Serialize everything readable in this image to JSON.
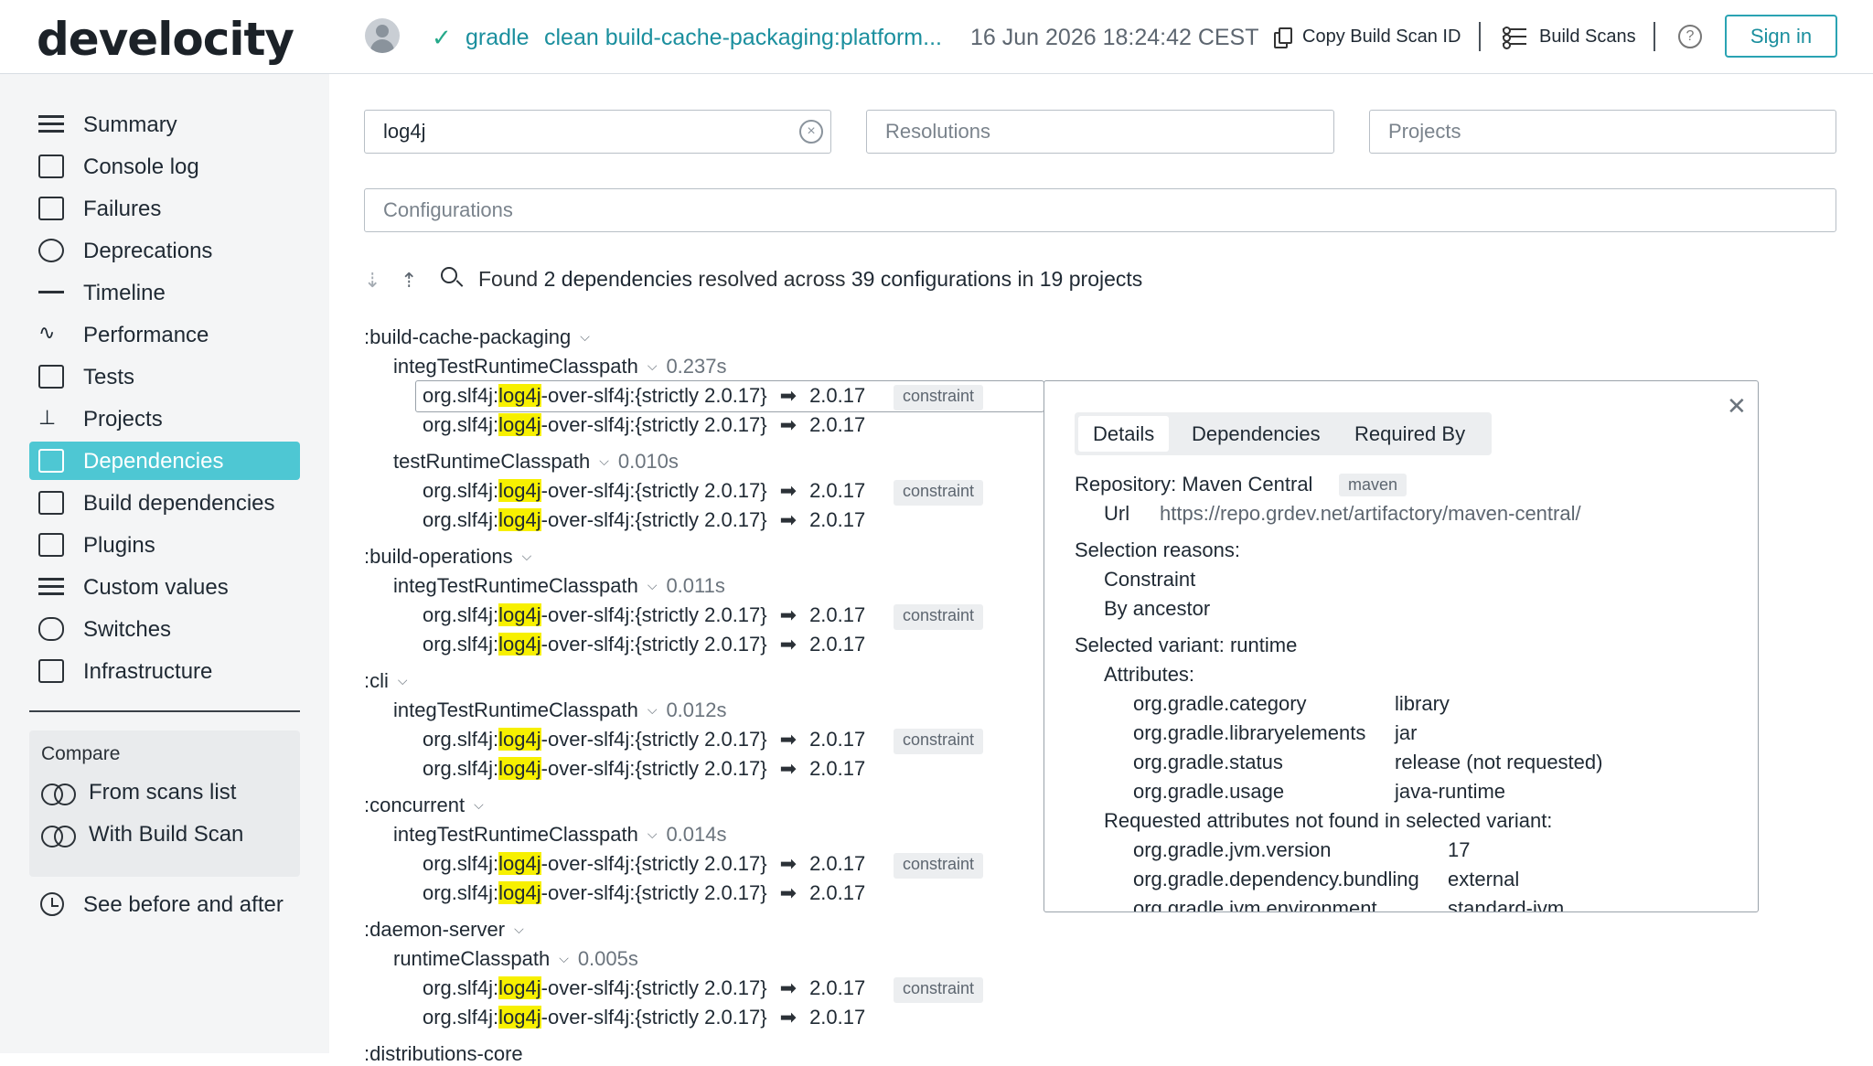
{
  "header": {
    "logo": "develocity",
    "tool": "gradle",
    "task": "clean build-cache-packaging:platform...",
    "date": "16 Jun 2026 18:24:42 CEST",
    "copy_label": "Copy Build Scan ID",
    "build_scans_label": "Build Scans",
    "help": "?",
    "signin_label": "Sign in"
  },
  "sidebar": {
    "items": [
      {
        "label": "Summary",
        "icon": "summary-icon"
      },
      {
        "label": "Console log",
        "icon": "console-icon"
      },
      {
        "label": "Failures",
        "icon": "failures-icon"
      },
      {
        "label": "Deprecations",
        "icon": "deprecations-icon"
      },
      {
        "label": "Timeline",
        "icon": "timeline-icon"
      },
      {
        "label": "Performance",
        "icon": "performance-icon"
      },
      {
        "label": "Tests",
        "icon": "tests-icon"
      },
      {
        "label": "Projects",
        "icon": "projects-icon"
      },
      {
        "label": "Dependencies",
        "icon": "dependencies-icon"
      },
      {
        "label": "Build dependencies",
        "icon": "build-dependencies-icon"
      },
      {
        "label": "Plugins",
        "icon": "plugins-icon"
      },
      {
        "label": "Custom values",
        "icon": "custom-values-icon"
      },
      {
        "label": "Switches",
        "icon": "switches-icon"
      },
      {
        "label": "Infrastructure",
        "icon": "infrastructure-icon"
      }
    ],
    "active": "Dependencies",
    "compare": {
      "title": "Compare",
      "from_scans": "From scans list",
      "with_build_scan": "With Build Scan"
    },
    "before_after": "See before and after"
  },
  "filters": {
    "search_value": "log4j",
    "resolutions_placeholder": "Resolutions",
    "projects_placeholder": "Projects",
    "configurations_placeholder": "Configurations"
  },
  "summary": {
    "found": "Found",
    "deps": "2 dependencies",
    "resolved": "resolved across",
    "configs": "39 configurations",
    "in": "in",
    "projects": "19 projects"
  },
  "tree": {
    "dep_prefix": "org.slf4j:",
    "dep_highlight": "log4j",
    "dep_suffix": "-over-slf4j:{strictly 2.0.17}",
    "version": "2.0.17",
    "constraint": "constraint",
    "projects": [
      {
        "name": ":build-cache-packaging",
        "configs": [
          {
            "name": "integTestRuntimeClasspath",
            "time": "0.237s"
          },
          {
            "name": "testRuntimeClasspath",
            "time": "0.010s"
          }
        ]
      },
      {
        "name": ":build-operations",
        "configs": [
          {
            "name": "integTestRuntimeClasspath",
            "time": "0.011s"
          }
        ]
      },
      {
        "name": ":cli",
        "configs": [
          {
            "name": "integTestRuntimeClasspath",
            "time": "0.012s"
          }
        ]
      },
      {
        "name": ":concurrent",
        "configs": [
          {
            "name": "integTestRuntimeClasspath",
            "time": "0.014s"
          }
        ]
      },
      {
        "name": ":daemon-server",
        "configs": [
          {
            "name": "runtimeClasspath",
            "time": "0.005s"
          }
        ]
      },
      {
        "name": ":distributions-core",
        "configs": []
      }
    ]
  },
  "popup": {
    "tabs": [
      "Details",
      "Dependencies",
      "Required By"
    ],
    "active_tab": "Details",
    "repository_label": "Repository: Maven Central",
    "repository_tag": "maven",
    "url_label": "Url",
    "url_value": "https://repo.grdev.net/artifactory/maven-central/",
    "selection_reasons": "Selection reasons:",
    "reasons": [
      "Constraint",
      "By ancestor"
    ],
    "selected_variant": "Selected variant: runtime",
    "attributes_label": "Attributes:",
    "attributes": [
      {
        "key": "org.gradle.category",
        "value": "library"
      },
      {
        "key": "org.gradle.libraryelements",
        "value": "jar"
      },
      {
        "key": "org.gradle.status",
        "value": "release (not requested)"
      },
      {
        "key": "org.gradle.usage",
        "value": "java-runtime"
      }
    ],
    "requested_label": "Requested attributes not found in selected variant:",
    "requested": [
      {
        "key": "org.gradle.jvm.version",
        "value": "17"
      },
      {
        "key": "org.gradle.dependency.bundling",
        "value": "external"
      },
      {
        "key": "org.gradle.jvm.environment",
        "value": "standard-jvm"
      }
    ]
  }
}
